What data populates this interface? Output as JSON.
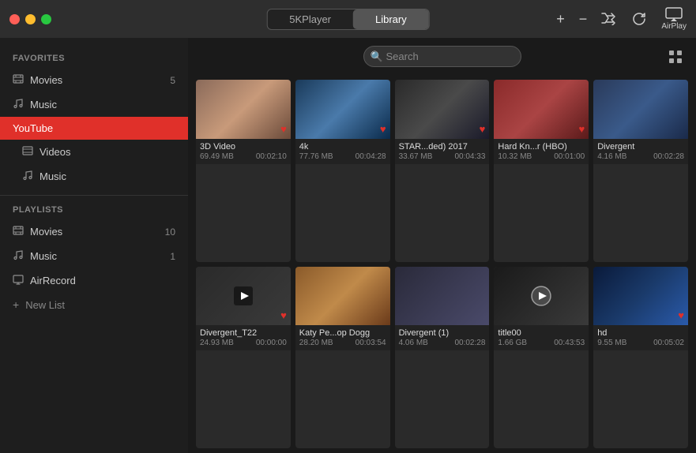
{
  "app": {
    "title": "5KPlayer",
    "tabs": [
      "5KPlayer",
      "Library"
    ],
    "active_tab": "Library"
  },
  "window_controls": {
    "close": "close",
    "minimize": "minimize",
    "maximize": "maximize"
  },
  "titlebar_icons": {
    "add": "+",
    "minus": "−",
    "shuffle": "shuffle",
    "refresh": "refresh",
    "airplay": "AirPlay"
  },
  "search": {
    "placeholder": "Search"
  },
  "sidebar": {
    "favorites_label": "Favorites",
    "playlists_label": "Playlists",
    "items": [
      {
        "id": "movies",
        "label": "Movies",
        "count": "5",
        "icon": "▦",
        "section": "favorites"
      },
      {
        "id": "music",
        "label": "Music",
        "count": "",
        "icon": "♪",
        "section": "favorites"
      },
      {
        "id": "youtube",
        "label": "YouTube",
        "count": "",
        "icon": "",
        "section": "youtube",
        "active": true
      },
      {
        "id": "videos",
        "label": "Videos",
        "count": "",
        "icon": "▦",
        "section": "youtube_sub"
      },
      {
        "id": "music2",
        "label": "Music",
        "count": "",
        "icon": "♪",
        "section": "youtube_sub"
      },
      {
        "id": "movies2",
        "label": "Movies",
        "count": "10",
        "icon": "▦",
        "section": "playlists"
      },
      {
        "id": "music3",
        "label": "Music",
        "count": "1",
        "icon": "♪",
        "section": "playlists"
      },
      {
        "id": "airrecord",
        "label": "AirRecord",
        "count": "",
        "icon": "⊙",
        "section": "playlists"
      }
    ],
    "new_list_label": "New List"
  },
  "videos": [
    {
      "id": "v1",
      "title": "3D Video",
      "size": "69.49 MB",
      "duration": "00:02:10",
      "thumb_class": "thumb-3d",
      "heart": true
    },
    {
      "id": "v2",
      "title": "4k",
      "size": "77.76 MB",
      "duration": "00:04:28",
      "thumb_class": "thumb-4k",
      "heart": true
    },
    {
      "id": "v3",
      "title": "STAR...ded) 2017",
      "size": "33.67 MB",
      "duration": "00:04:33",
      "thumb_class": "thumb-star",
      "heart": true
    },
    {
      "id": "v4",
      "title": "Hard Kn...r (HBO)",
      "size": "10.32 MB",
      "duration": "00:01:00",
      "thumb_class": "thumb-hkn",
      "heart": true
    },
    {
      "id": "v5",
      "title": "Divergent",
      "size": "4.16 MB",
      "duration": "00:02:28",
      "thumb_class": "thumb-div",
      "heart": false
    },
    {
      "id": "v6",
      "title": "Divergent_T22",
      "size": "24.93 MB",
      "duration": "00:00:00",
      "thumb_class": "thumb-div2",
      "heart": true,
      "youtube_overlay": true
    },
    {
      "id": "v7",
      "title": "Katy Pe...op Dogg",
      "size": "28.20 MB",
      "duration": "00:03:54",
      "thumb_class": "thumb-katy",
      "heart": false
    },
    {
      "id": "v8",
      "title": "Divergent (1)",
      "size": "4.06 MB",
      "duration": "00:02:28",
      "thumb_class": "thumb-div1",
      "heart": false,
      "youtube_overlay2": true
    },
    {
      "id": "v9",
      "title": "title00",
      "size": "1.66 GB",
      "duration": "00:43:53",
      "thumb_class": "thumb-t00",
      "heart": false,
      "play_icon": true
    },
    {
      "id": "v10",
      "title": "hd",
      "size": "9.55 MB",
      "duration": "00:05:02",
      "thumb_class": "thumb-hd",
      "heart": true
    }
  ]
}
